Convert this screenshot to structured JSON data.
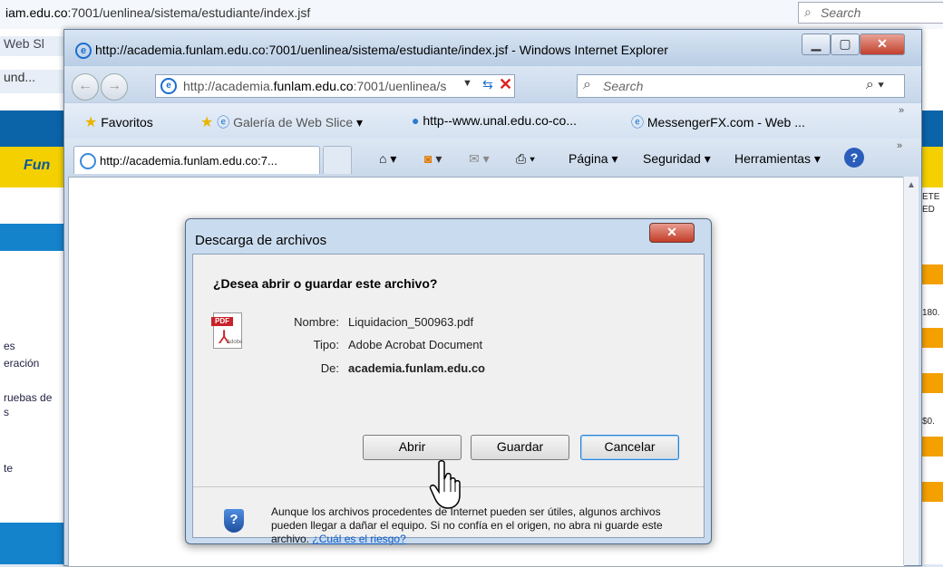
{
  "background": {
    "url_prefix": "iam.edu.co",
    "url_rest": ":7001/uenlinea/sistema/estudiante/index.jsf",
    "search_placeholder": "Search",
    "left_tab_1": "Web Sl",
    "left_tab_2": "und...",
    "left_brand": "Fun",
    "left_labels": [
      "es",
      "eración",
      "ruebas de",
      "s",
      "te"
    ],
    "right_labels": [
      "ETE .",
      "ED",
      "180.",
      "$0."
    ]
  },
  "ie": {
    "title": "http://academia.funlam.edu.co:7001/uenlinea/sistema/estudiante/index.jsf - Windows Internet Explorer",
    "address_prefix": "http://academia.",
    "address_host": "funlam.edu.co",
    "address_rest": ":7001/uenlinea/s",
    "search_placeholder": "Search",
    "favorites": {
      "label": "Favoritos",
      "items": [
        "Galería de Web Slice",
        "http--www.unal.edu.co-co...",
        "MessengerFX.com - Web ..."
      ]
    },
    "tab_title": "http://academia.funlam.edu.co:7...",
    "commands": [
      "Página",
      "Seguridad",
      "Herramientas"
    ]
  },
  "dialog": {
    "title": "Descarga de archivos",
    "question": "¿Desea abrir o guardar este archivo?",
    "name_label": "Nombre:",
    "name_value": "Liquidacion_500963.pdf",
    "type_label": "Tipo:",
    "type_value": "Adobe Acrobat Document",
    "from_label": "De:",
    "from_value": "academia.funlam.edu.co",
    "buttons": {
      "open": "Abrir",
      "save": "Guardar",
      "cancel": "Cancelar"
    },
    "warning_text": "Aunque los archivos procedentes de Internet pueden ser útiles, algunos archivos pueden llegar a dañar el equipo. Si no confía en el origen, no abra ni guarde este archivo.",
    "warning_link": "¿Cuál es el riesgo?",
    "pdf_tag": "PDF",
    "pdf_sub": "Adobe"
  }
}
